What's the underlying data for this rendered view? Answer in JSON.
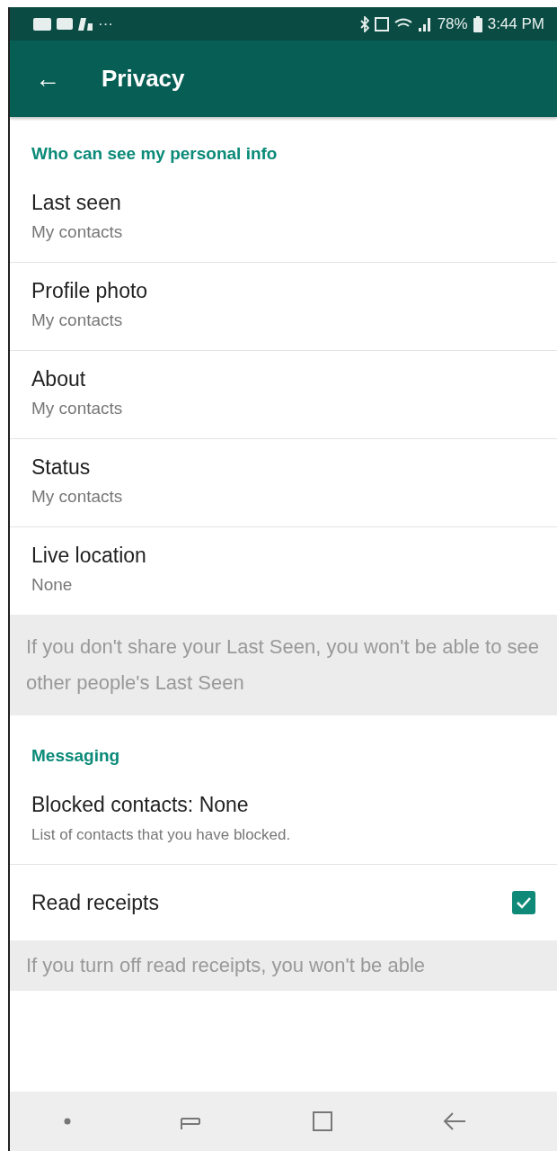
{
  "status_bar": {
    "notifications_more": "···",
    "battery": "78%",
    "time": "3:44 PM"
  },
  "app_bar": {
    "back": "←",
    "title": "Privacy"
  },
  "blocks": [
    {
      "kind": "header",
      "text": "Who can see my personal info"
    },
    {
      "kind": "setting",
      "title": "Last seen",
      "value": "My contacts"
    },
    {
      "kind": "setting",
      "title": "Profile photo",
      "value": "My contacts"
    },
    {
      "kind": "setting",
      "title": "About",
      "value": "My contacts"
    },
    {
      "kind": "setting",
      "title": "Status",
      "value": "My contacts"
    },
    {
      "kind": "setting",
      "title": "Live location",
      "value": "None"
    },
    {
      "kind": "note",
      "text": "If you don't share your Last Seen, you won't be able to see other people's Last Seen"
    },
    {
      "kind": "header",
      "text": "Messaging"
    },
    {
      "kind": "described",
      "title": "Blocked contacts: None",
      "value": "List of contacts that you have blocked."
    },
    {
      "kind": "toggle",
      "title": "Read receipts",
      "checked": true
    },
    {
      "kind": "note",
      "text": "If you turn off read receipts, you won't be able"
    }
  ]
}
